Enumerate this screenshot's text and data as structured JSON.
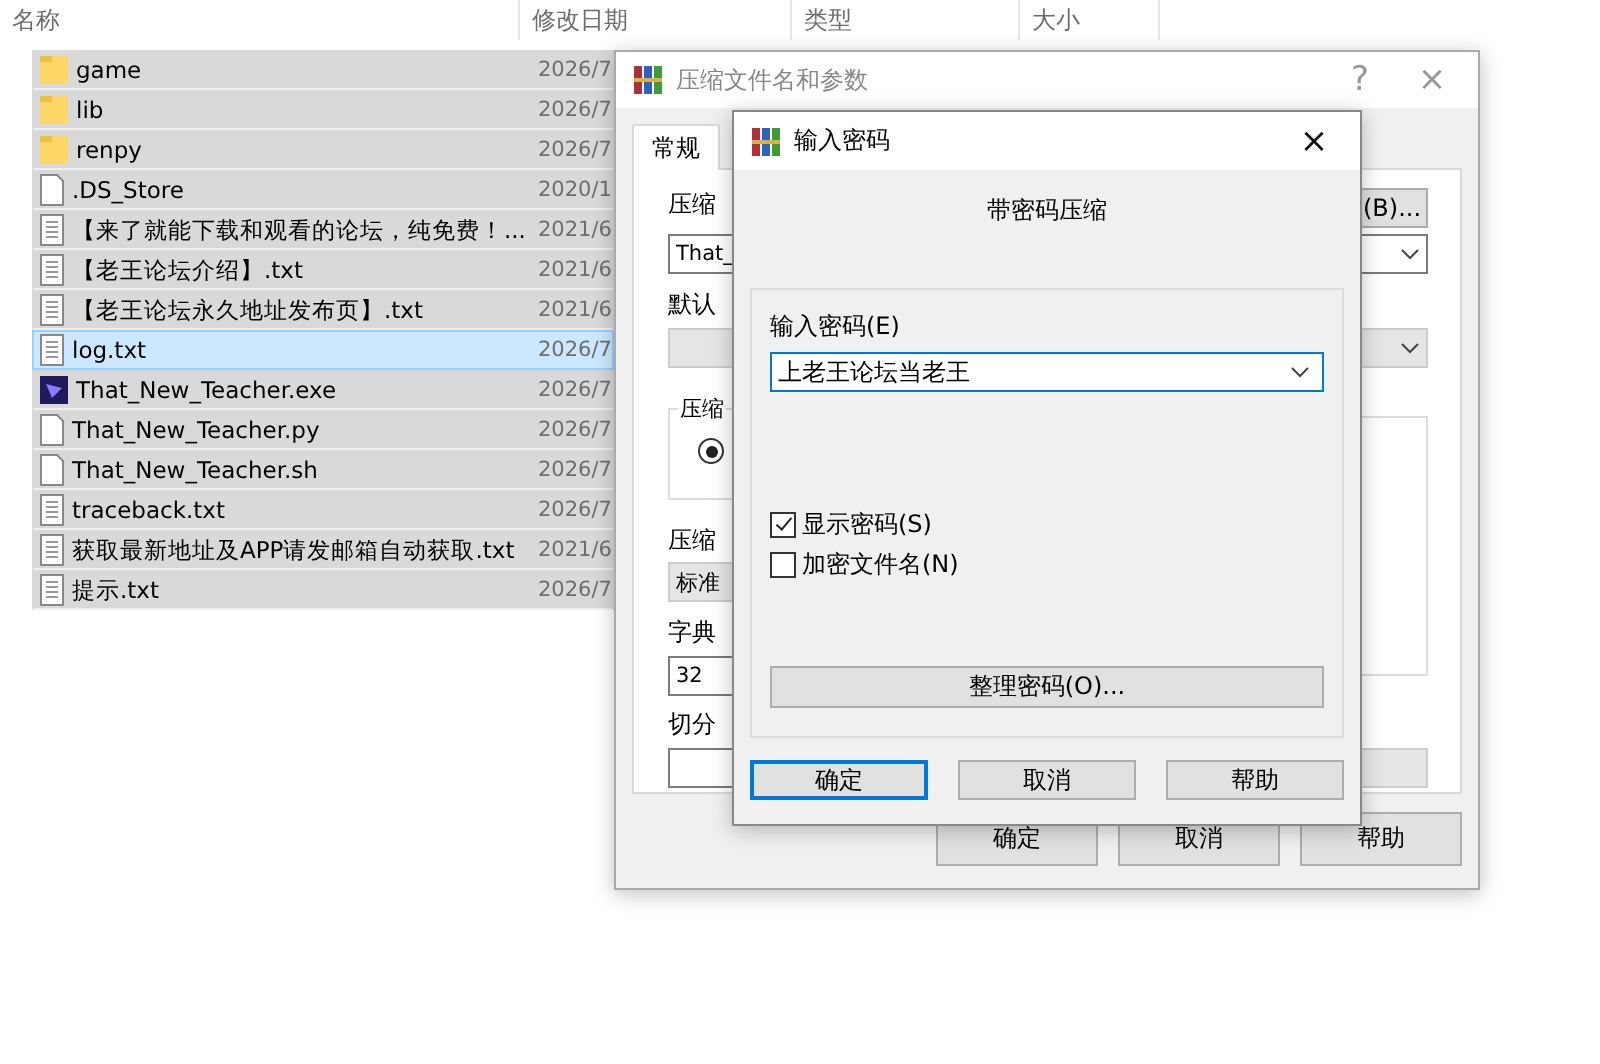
{
  "explorer": {
    "columns": [
      "名称",
      "修改日期",
      "类型",
      "大小"
    ],
    "rows": [
      {
        "name": "game",
        "date": "2026/7",
        "kind": "folder",
        "selected": true,
        "focused": false
      },
      {
        "name": "lib",
        "date": "2026/7",
        "kind": "folder",
        "selected": true,
        "focused": false
      },
      {
        "name": "renpy",
        "date": "2026/7",
        "kind": "folder",
        "selected": true,
        "focused": false
      },
      {
        "name": ".DS_Store",
        "date": "2020/1",
        "kind": "blank",
        "selected": true,
        "focused": false
      },
      {
        "name": "【来了就能下载和观看的论坛，纯免费！...",
        "date": "2021/6",
        "kind": "text",
        "selected": true,
        "focused": false
      },
      {
        "name": "【老王论坛介绍】.txt",
        "date": "2021/6",
        "kind": "text",
        "selected": true,
        "focused": false
      },
      {
        "name": "【老王论坛永久地址发布页】.txt",
        "date": "2021/6",
        "kind": "text",
        "selected": true,
        "focused": false
      },
      {
        "name": "log.txt",
        "date": "2026/7",
        "kind": "text",
        "selected": true,
        "focused": true
      },
      {
        "name": "That_New_Teacher.exe",
        "date": "2026/7",
        "kind": "exe",
        "selected": true,
        "focused": false
      },
      {
        "name": "That_New_Teacher.py",
        "date": "2026/7",
        "kind": "blank",
        "selected": true,
        "focused": false
      },
      {
        "name": "That_New_Teacher.sh",
        "date": "2026/7",
        "kind": "blank",
        "selected": true,
        "focused": false
      },
      {
        "name": "traceback.txt",
        "date": "2026/7",
        "kind": "text",
        "selected": true,
        "focused": false
      },
      {
        "name": "获取最新地址及APP请发邮箱自动获取.txt",
        "date": "2021/6",
        "kind": "text",
        "selected": true,
        "focused": false
      },
      {
        "name": "提示.txt",
        "date": "2026/7",
        "kind": "text",
        "selected": true,
        "focused": false
      }
    ]
  },
  "archive_dialog": {
    "title": "压缩文件名和参数",
    "help": "?",
    "close": "×",
    "tabs": [
      {
        "label": "常规",
        "selected": true
      }
    ],
    "browse_button": "(B)...",
    "name_label": "压缩",
    "name_value": "That_",
    "profile_label": "默认",
    "format_group": "压缩",
    "format_radio": {
      "selected": true
    },
    "method_label": "压缩",
    "method_value": "标准",
    "dict_label": "字典",
    "dict_value": "32",
    "split_label": "切分",
    "buttons": [
      "确定",
      "取消",
      "帮助"
    ]
  },
  "password_dialog": {
    "title": "输入密码",
    "close": "×",
    "heading": "带密码压缩",
    "password_label": "输入密码(E)",
    "password_value": "上老王论坛当老王",
    "options": [
      {
        "label": "显示密码(S)",
        "checked": true
      },
      {
        "label": "加密文件名(N)",
        "checked": false
      }
    ],
    "organize_button": "整理密码(O)...",
    "buttons": [
      {
        "label": "确定",
        "default": true
      },
      {
        "label": "取消",
        "default": false
      },
      {
        "label": "帮助",
        "default": false
      }
    ]
  }
}
